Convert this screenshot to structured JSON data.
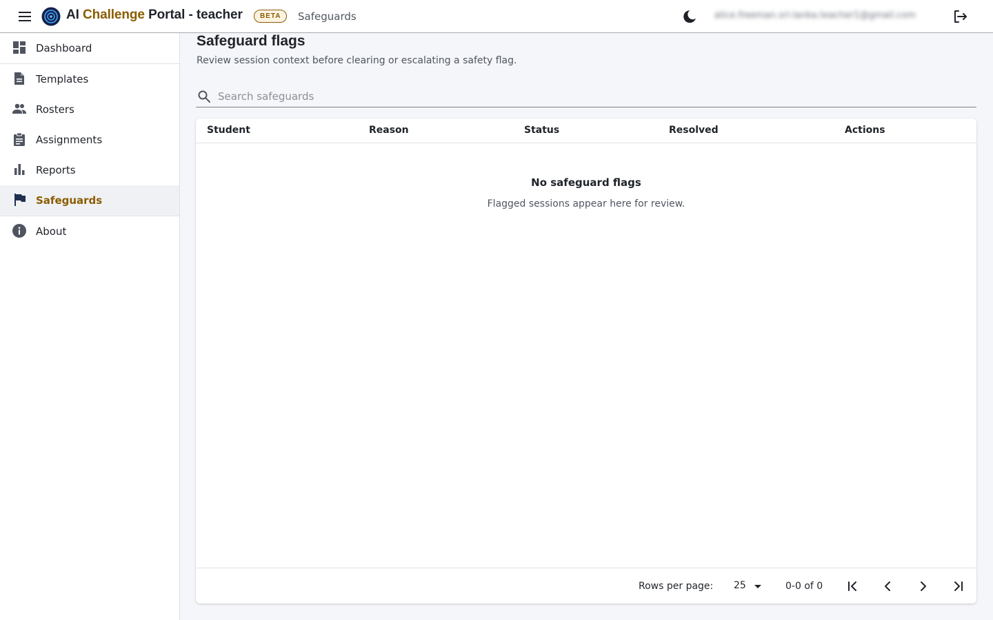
{
  "appbar": {
    "brand_prefix": "AI ",
    "brand_accent": "Challenge",
    "brand_suffix": " Portal - teacher",
    "beta_label": "BETA",
    "breadcrumb": "Safeguards",
    "user_email": "alice.freeman.sri-lanka.teacher1@gmail.com",
    "icons": {
      "menu": "hamburger-menu-icon",
      "theme": "moon-icon",
      "logout": "logout-icon"
    }
  },
  "sidebar": {
    "items": [
      {
        "label": "Dashboard",
        "icon": "dashboard-icon"
      },
      {
        "label": "Templates",
        "icon": "document-icon"
      },
      {
        "label": "Rosters",
        "icon": "people-icon"
      },
      {
        "label": "Assignments",
        "icon": "clipboard-icon"
      },
      {
        "label": "Reports",
        "icon": "bar-chart-icon"
      },
      {
        "label": "Safeguards",
        "icon": "flag-icon",
        "active": true
      },
      {
        "label": "About",
        "icon": "info-icon"
      }
    ]
  },
  "main": {
    "title": "Safeguard flags",
    "subtitle": "Review session context before clearing or escalating a safety flag.",
    "search_placeholder": "Search safeguards",
    "search_value": "",
    "table": {
      "columns": [
        "Student",
        "Reason",
        "Status",
        "Resolved",
        "Actions"
      ],
      "rows": [],
      "empty_title": "No safeguard flags",
      "empty_subtitle": "Flagged sessions appear here for review."
    },
    "pagination": {
      "rows_per_page_label": "Rows per page:",
      "rows_per_page": "25",
      "range": "0-0 of 0"
    }
  },
  "colors": {
    "accent": "#8a5c00",
    "text": "#1f2329",
    "muted": "#4f5560",
    "background": "#f5f6f9"
  }
}
